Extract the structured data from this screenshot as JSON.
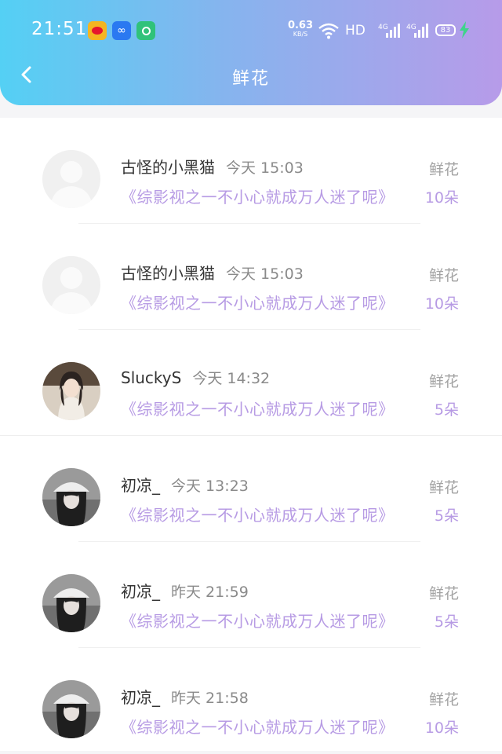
{
  "status_bar": {
    "time": "21:51",
    "net_speed_value": "0.63",
    "net_speed_unit": "KB/S",
    "hd_label": "HD",
    "signal1_label": "4G",
    "signal2_label": "4G",
    "battery": "83"
  },
  "header": {
    "title": "鲜花"
  },
  "records": [
    {
      "name": "古怪的小黑猫",
      "time": "今天 15:03",
      "book": "《综影视之一不小心就成万人迷了呢》",
      "gift": "鲜花",
      "count": "10朵",
      "avatar": "default"
    },
    {
      "name": "古怪的小黑猫",
      "time": "今天 15:03",
      "book": "《综影视之一不小心就成万人迷了呢》",
      "gift": "鲜花",
      "count": "10朵",
      "avatar": "default"
    },
    {
      "name": "SluckyS",
      "time": "今天 14:32",
      "book": "《综影视之一不小心就成万人迷了呢》",
      "gift": "鲜花",
      "count": "5朵",
      "avatar": "photo-light"
    },
    {
      "name": "初凉_",
      "time": "今天 13:23",
      "book": "《综影视之一不小心就成万人迷了呢》",
      "gift": "鲜花",
      "count": "5朵",
      "avatar": "photo-dark"
    },
    {
      "name": "初凉_",
      "time": "昨天 21:59",
      "book": "《综影视之一不小心就成万人迷了呢》",
      "gift": "鲜花",
      "count": "5朵",
      "avatar": "photo-dark"
    },
    {
      "name": "初凉_",
      "time": "昨天 21:58",
      "book": "《综影视之一不小心就成万人迷了呢》",
      "gift": "鲜花",
      "count": "10朵",
      "avatar": "photo-dark"
    }
  ]
}
